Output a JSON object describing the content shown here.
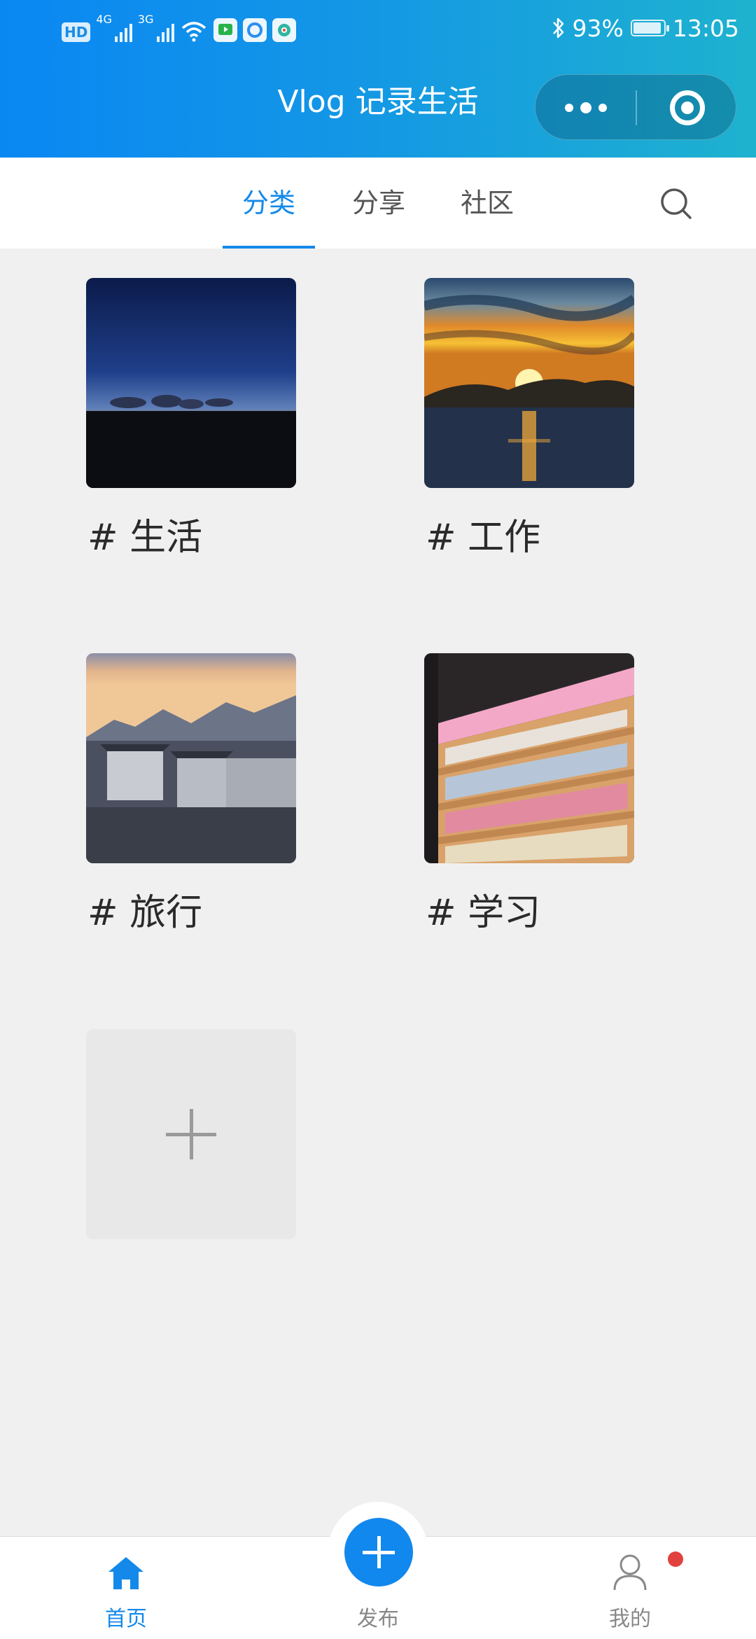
{
  "status_bar": {
    "hd": "HD",
    "net1": "4G",
    "net2": "3G",
    "battery_percent": "93%",
    "battery_level": 0.93,
    "time": "13:05"
  },
  "header": {
    "title": "Vlog 记录生活"
  },
  "tabs": [
    {
      "label": "分类",
      "active": true
    },
    {
      "label": "分享",
      "active": false
    },
    {
      "label": "社区",
      "active": false
    }
  ],
  "categories": [
    {
      "label": "# 生活",
      "image": "night-sky-horizon"
    },
    {
      "label": "# 工作",
      "image": "sunset-over-lake"
    },
    {
      "label": "# 旅行",
      "image": "old-village-mountains"
    },
    {
      "label": "# 学习",
      "image": "bookstore-shelves"
    }
  ],
  "bottom_nav": {
    "home": "首页",
    "publish": "发布",
    "mine": "我的"
  },
  "colors": {
    "accent": "#1489e9",
    "header_start": "#0a87f3",
    "header_end": "#1eb2cf",
    "background": "#f0f0f0",
    "badge": "#e2423f"
  }
}
